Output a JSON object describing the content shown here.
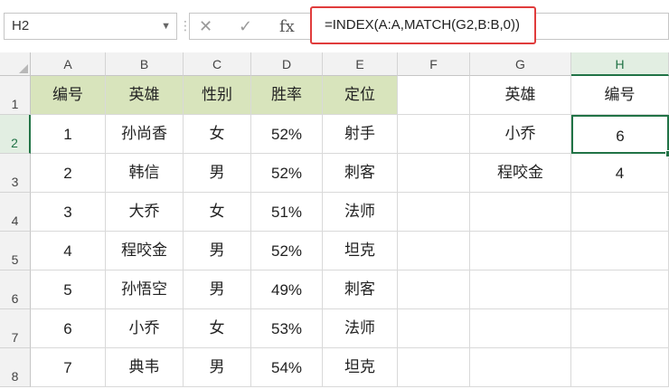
{
  "name_box": "H2",
  "formula_bar": {
    "cancel_icon": "✕",
    "enter_icon": "✓",
    "fx_icon": "fx",
    "formula": "=INDEX(A:A,MATCH(G2,B:B,0))"
  },
  "columns": [
    "A",
    "B",
    "C",
    "D",
    "E",
    "F",
    "G",
    "H"
  ],
  "rows": [
    "1",
    "2",
    "3",
    "4",
    "5",
    "6",
    "7",
    "8"
  ],
  "active_cell": "H2",
  "accent_color": "#217346",
  "header_fill": "#d8e4bc",
  "highlight_border": "#e03c3c",
  "table": {
    "headers": [
      "编号",
      "英雄",
      "性别",
      "胜率",
      "定位"
    ],
    "rows": [
      [
        "1",
        "孙尚香",
        "女",
        "52%",
        "射手"
      ],
      [
        "2",
        "韩信",
        "男",
        "52%",
        "刺客"
      ],
      [
        "3",
        "大乔",
        "女",
        "51%",
        "法师"
      ],
      [
        "4",
        "程咬金",
        "男",
        "52%",
        "坦克"
      ],
      [
        "5",
        "孙悟空",
        "男",
        "49%",
        "刺客"
      ],
      [
        "6",
        "小乔",
        "女",
        "53%",
        "法师"
      ],
      [
        "7",
        "典韦",
        "男",
        "54%",
        "坦克"
      ]
    ]
  },
  "lookup": {
    "headers": [
      "英雄",
      "编号"
    ],
    "rows": [
      [
        "小乔",
        "6"
      ],
      [
        "程咬金",
        "4"
      ]
    ]
  }
}
